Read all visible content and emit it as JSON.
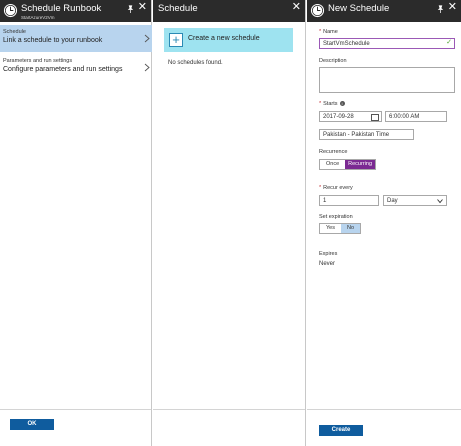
{
  "blade1": {
    "title": "Schedule Runbook",
    "subtitle": "StartAzureV2Vm",
    "items": [
      {
        "title": "Schedule",
        "desc": "Link a schedule to your runbook"
      },
      {
        "title": "Parameters and run settings",
        "desc": "Configure parameters and run settings"
      }
    ],
    "ok_label": "OK"
  },
  "blade2": {
    "title": "Schedule",
    "create_label": "Create a new schedule",
    "empty_message": "No schedules found."
  },
  "blade3": {
    "title": "New Schedule",
    "name_label": "Name",
    "name_value": "StartVmSchedule",
    "description_label": "Description",
    "description_value": "",
    "starts_label": "Starts",
    "start_date": "2017-09-28",
    "start_time": "6:00:00 AM",
    "timezone": "Pakistan - Pakistan Time",
    "recurrence_label": "Recurrence",
    "recurrence_options": [
      "Once",
      "Recurring"
    ],
    "recur_every_label": "Recur every",
    "recur_every_value": "1",
    "recur_unit": "Day",
    "set_expiration_label": "Set expiration",
    "expiration_options": [
      "Yes",
      "No"
    ],
    "expires_label": "Expires",
    "expires_value": "Never",
    "create_button": "Create"
  },
  "icons": {
    "header": "clock-icon",
    "pin": "pin-icon",
    "close": "close-icon",
    "chevron": "chevron-right-icon",
    "plus": "plus-icon",
    "calendar": "calendar-icon",
    "dropdown": "chevron-down-icon",
    "check": "checkmark-icon",
    "info": "info-icon"
  },
  "colors": {
    "header_bg": "#2b2b2b",
    "selected_bg": "#b8d4ee",
    "primary_button": "#0f5c9e",
    "create_tile": "#9ee3f0",
    "recurring_on": "#7b2a92",
    "required": "#c0282d"
  }
}
